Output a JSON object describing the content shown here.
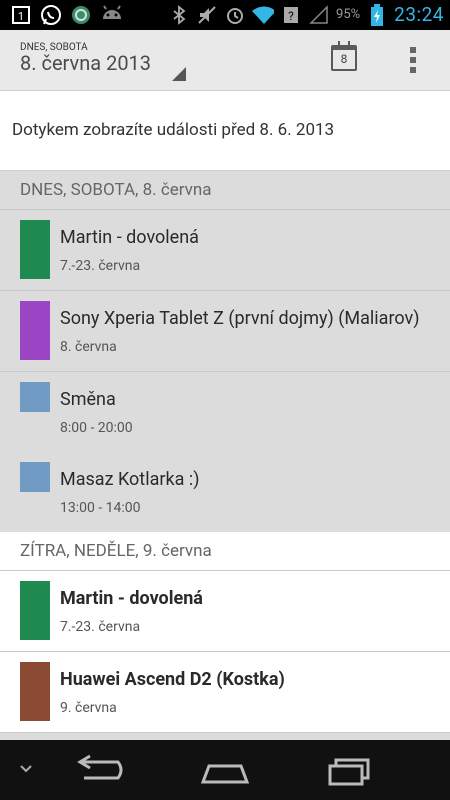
{
  "status": {
    "battery_percent": "95%",
    "time": "23:24",
    "icons": [
      "notification-1-icon",
      "whatsapp-icon",
      "app-icon",
      "android-icon",
      "bluetooth-icon",
      "mute-icon",
      "alarm-icon",
      "wifi-icon",
      "unknown-signal-icon",
      "cell-signal-icon",
      "battery-charging-icon"
    ],
    "badge_number": "1"
  },
  "actionbar": {
    "small_label": "DNES, SOBOTA",
    "title": "8. června 2013",
    "calendar_day": "8"
  },
  "touch_hint": "Dotykem zobrazíte události před 8. 6. 2013",
  "sections": [
    {
      "header": "DNES, SOBOTA, 8. června",
      "events": [
        {
          "title": "Martin - dovolená",
          "sub": "7.-23. června",
          "color": "#1e8a4f"
        },
        {
          "title": "Sony Xperia Tablet Z (první dojmy) (Maliarov)",
          "sub": "8. června",
          "color": "#9b45c4"
        },
        {
          "title": "Směna",
          "sub": "8:00 - 20:00",
          "color": "#6f9bc4"
        },
        {
          "title": "Masaz Kotlarka :)",
          "sub": "13:00 - 14:00",
          "color": "#6f9bc4"
        }
      ]
    },
    {
      "header": "ZÍTRA, NEDĚLE, 9. června",
      "events": [
        {
          "title": "Martin - dovolená",
          "sub": "7.-23. června",
          "color": "#1e8a4f"
        },
        {
          "title": "Huawei Ascend D2 (Kostka)",
          "sub": "9. června",
          "color": "#8b4a34"
        }
      ]
    }
  ]
}
